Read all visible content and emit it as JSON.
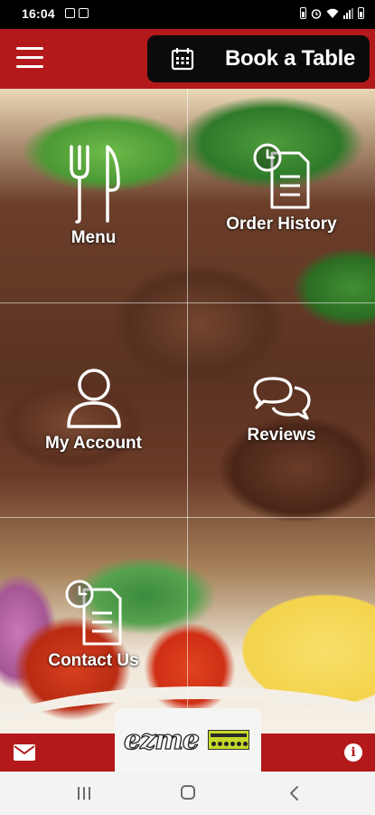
{
  "status_bar": {
    "time": "16:04",
    "left_icons": [
      "gmail-icon",
      "notification-icon"
    ],
    "right_icons": [
      "battery-saver-icon",
      "alarm-icon",
      "wifi-icon",
      "signal-icon",
      "battery-icon"
    ]
  },
  "header": {
    "menu_icon": "hamburger-menu-icon",
    "book_button": {
      "label": "Book a Table",
      "icon": "calendar-icon"
    }
  },
  "tiles": [
    {
      "label": "Menu",
      "icon": "fork-knife-icon"
    },
    {
      "label": "Order History",
      "icon": "document-clock-icon"
    },
    {
      "label": "My Account",
      "icon": "user-icon"
    },
    {
      "label": "Reviews",
      "icon": "chat-bubbles-icon"
    },
    {
      "label": "Contact Us",
      "icon": "document-clock-icon"
    }
  ],
  "footer": {
    "mail_icon": "mail-icon",
    "info_icon": "info-icon",
    "info_glyph": "i",
    "logo_text": "ezme",
    "badge_icon": "food-hygiene-rating-badge"
  },
  "nav_bar": {
    "buttons": [
      "recents-button",
      "home-button",
      "back-button"
    ]
  },
  "colors": {
    "brand_red": "#b3191b",
    "button_black": "#0b0b0b"
  }
}
